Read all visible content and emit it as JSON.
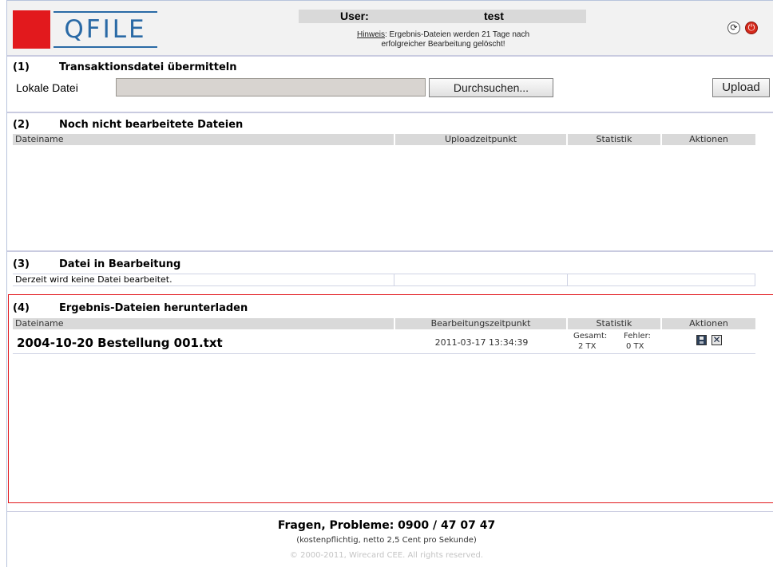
{
  "header": {
    "logo_text": "QFILE",
    "user_label": "User:",
    "user_value": "test",
    "hint_link": "Hinweis",
    "hint_line1": ": Ergebnis-Dateien werden 21 Tage nach",
    "hint_line2": "erfolgreicher Bearbeitung gelöscht!",
    "refresh_icon": "refresh-icon",
    "logout_icon": "power-icon",
    "brand_red": "#e2191d",
    "brand_blue": "#2a6aa6"
  },
  "section1": {
    "number": "(1)",
    "title": "Transaktionsdatei übermitteln",
    "local_file_label": "Lokale Datei",
    "file_value": "",
    "browse_label": "Durchsuchen...",
    "upload_label": "Upload"
  },
  "section2": {
    "number": "(2)",
    "title": "Noch nicht bearbeitete Dateien",
    "columns": [
      "Dateiname",
      "Uploadzeitpunkt",
      "Statistik",
      "Aktionen"
    ]
  },
  "section3": {
    "number": "(3)",
    "title": "Datei in Bearbeitung",
    "empty_text": "Derzeit wird keine Datei bearbeitet."
  },
  "section4": {
    "number": "(4)",
    "title": "Ergebnis-Dateien herunterladen",
    "columns": [
      "Dateiname",
      "Bearbeitungszeitpunkt",
      "Statistik",
      "Aktionen"
    ],
    "rows": [
      {
        "filename": "2004-10-20 Bestellung 001.txt",
        "processed_at": "2011-03-17 13:34:39",
        "total_label": "Gesamt:",
        "total_value": "2 TX",
        "error_label": "Fehler:",
        "error_value": "0 TX",
        "save_icon": "save-icon",
        "delete_icon": "delete-icon"
      }
    ],
    "highlight_color": "#e2191d"
  },
  "footer": {
    "contact": "Fragen, Probleme: 0900 / 47 07 47",
    "cost_note": "(kostenpflichtig, netto 2,5 Cent pro Sekunde)",
    "copyright": "© 2000-2011, Wirecard CEE. All rights reserved."
  }
}
